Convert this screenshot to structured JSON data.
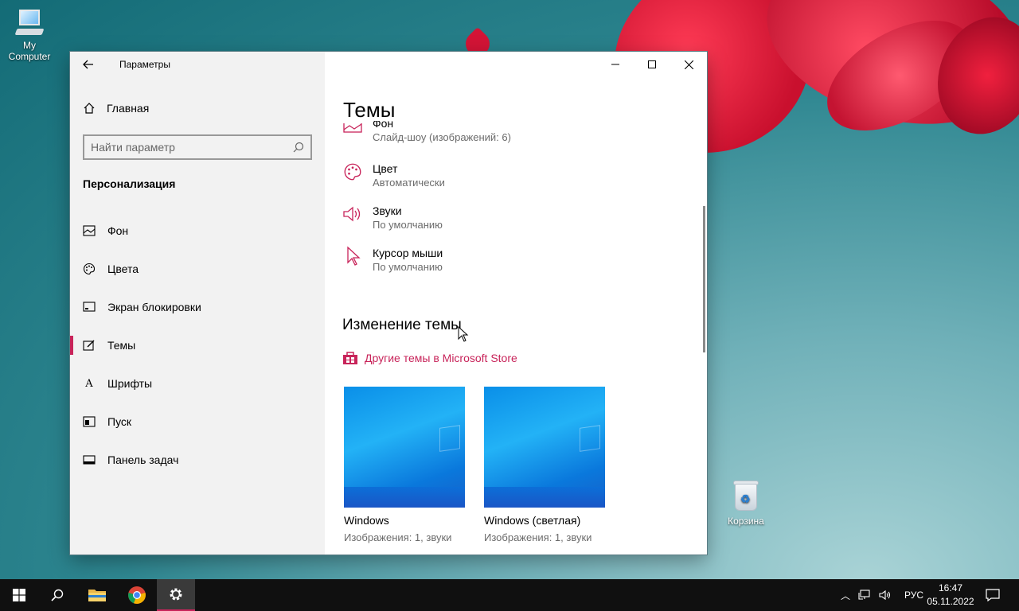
{
  "desktop": {
    "icons": [
      {
        "label": "My Computer"
      },
      {
        "label": "Корзина"
      }
    ]
  },
  "window": {
    "app_title": "Параметры",
    "sidebar": {
      "home_label": "Главная",
      "search_placeholder": "Найти параметр",
      "section_title": "Персонализация",
      "items": [
        {
          "label": "Фон",
          "icon": "picture-icon"
        },
        {
          "label": "Цвета",
          "icon": "palette-icon"
        },
        {
          "label": "Экран блокировки",
          "icon": "lock-screen-icon"
        },
        {
          "label": "Темы",
          "icon": "themes-icon",
          "active": true
        },
        {
          "label": "Шрифты",
          "icon": "fonts-icon"
        },
        {
          "label": "Пуск",
          "icon": "start-icon"
        },
        {
          "label": "Панель задач",
          "icon": "taskbar-icon"
        }
      ]
    },
    "content": {
      "page_title": "Темы",
      "settings": [
        {
          "title": "Фон",
          "value": "Слайд-шоу (изображений: 6)",
          "icon": "picture-icon"
        },
        {
          "title": "Цвет",
          "value": "Автоматически",
          "icon": "palette-icon"
        },
        {
          "title": "Звуки",
          "value": "По умолчанию",
          "icon": "speaker-icon"
        },
        {
          "title": "Курсор мыши",
          "value": "По умолчанию",
          "icon": "cursor-icon"
        }
      ],
      "change_theme_title": "Изменение темы",
      "store_link": "Другие темы в Microsoft Store",
      "themes": [
        {
          "name": "Windows",
          "details": "Изображения: 1, звуки"
        },
        {
          "name": "Windows (светлая)",
          "details": "Изображения: 1, звуки"
        }
      ]
    }
  },
  "taskbar": {
    "language": "РУС",
    "time": "16:47",
    "date": "05.11.2022"
  },
  "colors": {
    "accent": "#c8245a",
    "sidebar_bg": "#f2f2f2",
    "taskbar_bg": "#101010"
  }
}
